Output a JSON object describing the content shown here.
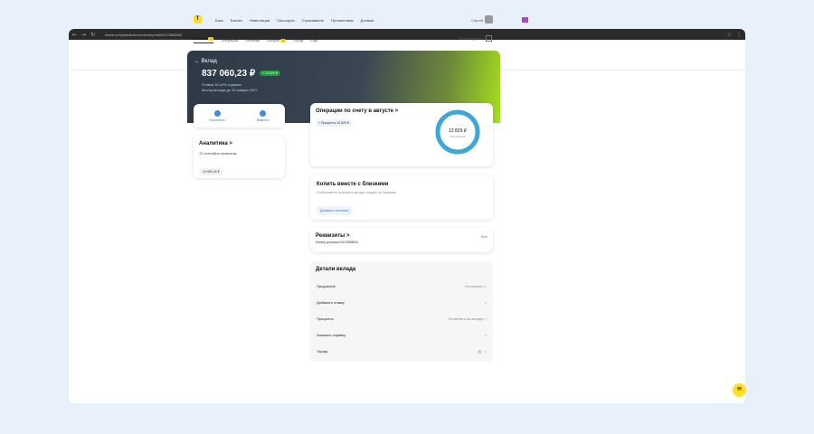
{
  "browser": {
    "url": "tbank.ru/mybank/accounts/deposit/5147588834/"
  },
  "header": {
    "logo": "T",
    "nav": [
      "Банк",
      "Бизнес",
      "Инвестиции",
      "Сим-карта",
      "Страхование",
      "Путешествия",
      "Долями"
    ],
    "search": "Сергей"
  },
  "subnav": {
    "items": [
      "Главная",
      "Операции",
      "Платежи",
      "Бонусы",
      "Город",
      "Ещё"
    ],
    "badge_home": "1",
    "badge_bonus": "3",
    "all_products": "Все продукты"
  },
  "hero": {
    "back": "← Вклад",
    "amount": "837 060,23 ₽",
    "tag": "+ 13 829 ₽",
    "line1": "Ставка 16,19% годовых",
    "line2": "Месяц вклада до 15 января 2027"
  },
  "actions": [
    {
      "label": "Пополнить"
    },
    {
      "label": "Вывести"
    }
  ],
  "analytics": {
    "title": "Аналитика >",
    "subtitle": "13 сентября зачислим",
    "value": "19 992,15 ₽"
  },
  "operations": {
    "title": "Операции по счету в августе >",
    "chip": "+ Проценты 13 829 ₽",
    "ring_amount": "13 829 ₽",
    "ring_label": "Пополнения"
  },
  "save_together": {
    "title": "Копить вместе с близкими",
    "text": "Чтобы вместе пополнять вклады создать за близкими",
    "button": "Добавить человека"
  },
  "requisites": {
    "title": "Реквизиты >",
    "number": "Номер договора 5147588834",
    "all": "Все"
  },
  "details": {
    "title": "Детали вклада",
    "rows": [
      {
        "label": "Продление",
        "value": "Отключено >"
      },
      {
        "label": "Добавить ставку",
        "value": ">"
      },
      {
        "label": "Проценты",
        "value": "Оставлять на вкладе >"
      },
      {
        "label": "Заказать справку",
        "value": ">"
      },
      {
        "label": "Тариф",
        "value": ">"
      }
    ]
  },
  "colors": {
    "accent": "#ffdd2d",
    "blue": "#3a7bd5",
    "ring": "#3fa7d6"
  }
}
